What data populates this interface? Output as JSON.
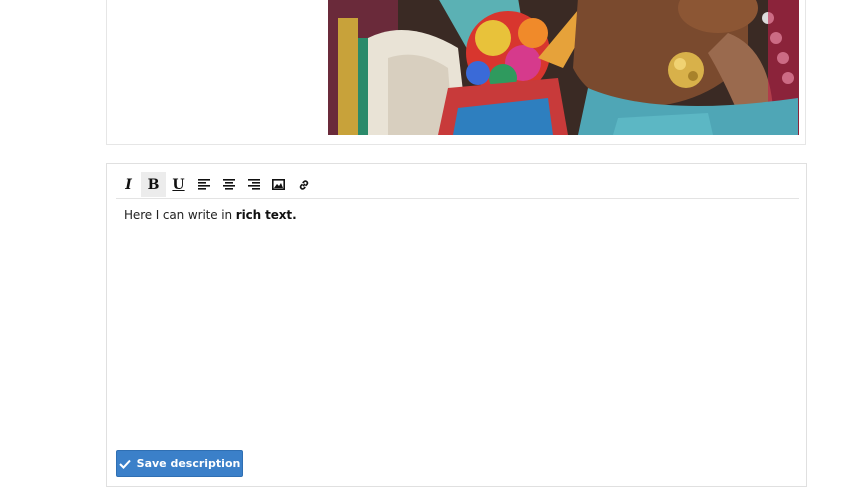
{
  "photo": {
    "description_icon": "photo"
  },
  "editor": {
    "toolbar": [
      {
        "name": "italic-button",
        "glyph": "I",
        "icon": "italic-icon"
      },
      {
        "name": "bold-button",
        "glyph": "B",
        "icon": "bold-icon",
        "active": true
      },
      {
        "name": "underline-button",
        "glyph": "U",
        "icon": "underline-icon"
      },
      {
        "name": "align-left-button",
        "icon": "align-left-icon"
      },
      {
        "name": "align-center-button",
        "icon": "align-center-icon"
      },
      {
        "name": "align-right-button",
        "icon": "align-right-icon"
      },
      {
        "name": "insert-image-button",
        "icon": "image-icon"
      },
      {
        "name": "insert-link-button",
        "icon": "link-icon"
      }
    ],
    "content": {
      "plain_text": "Here I can write in ",
      "bold_text": "rich text."
    }
  },
  "save_button": {
    "label": "Save description",
    "icon": "check-icon",
    "color": "#3b80c9"
  }
}
